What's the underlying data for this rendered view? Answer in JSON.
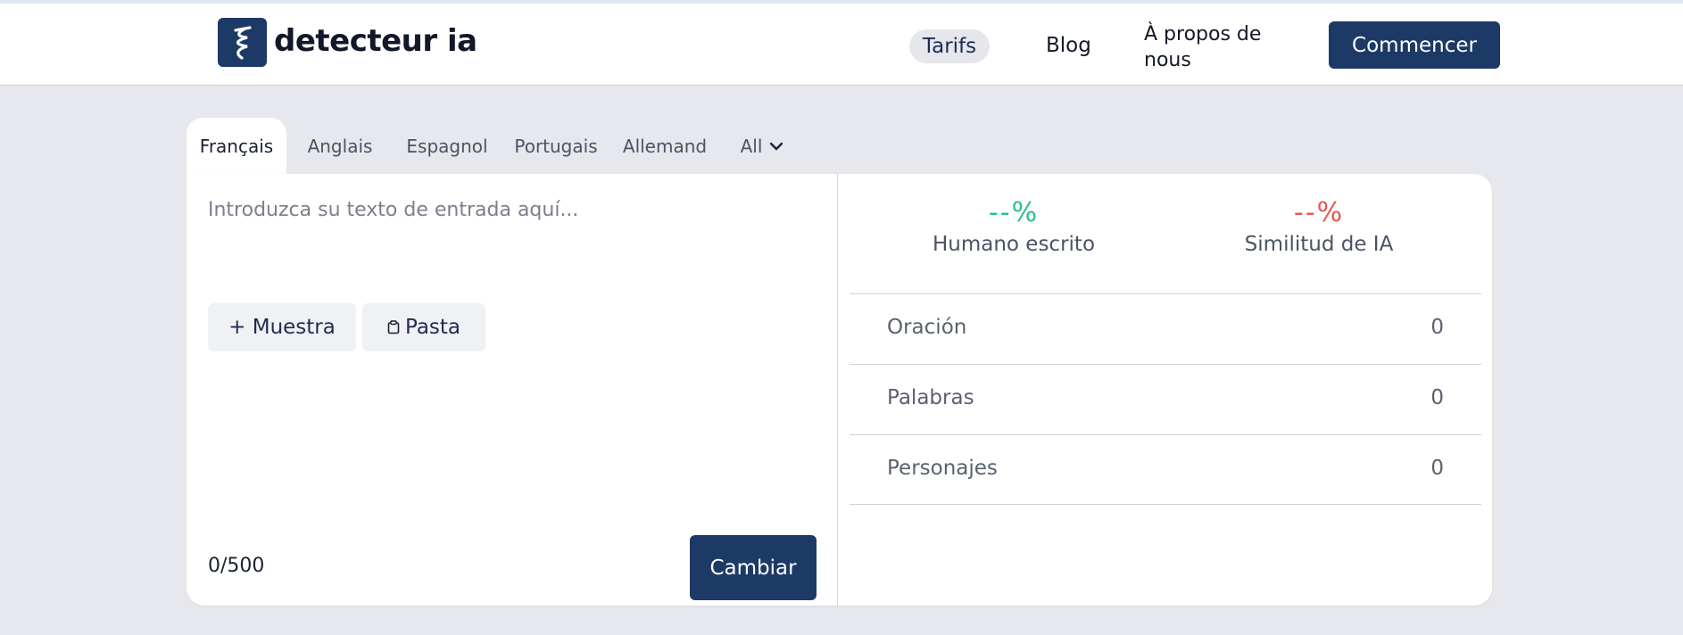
{
  "header": {
    "logo_text": "detecteur ia",
    "nav": {
      "tarifs": "Tarifs",
      "blog": "Blog",
      "about": "À propos de nous"
    },
    "cta": "Commencer"
  },
  "tabs": [
    {
      "label": "Français",
      "active": true
    },
    {
      "label": "Anglais"
    },
    {
      "label": "Espagnol"
    },
    {
      "label": "Portugais"
    },
    {
      "label": "Allemand"
    },
    {
      "label": "All"
    }
  ],
  "input": {
    "placeholder": "Introduzca su texto de entrada aquí...",
    "sample_button": "+ Muestra",
    "paste_button": "Pasta",
    "counter": "0/500",
    "submit_button": "Cambiar"
  },
  "results": {
    "human": {
      "value": "--%",
      "label": "Humano escrito",
      "color": "#2bbf8a"
    },
    "ai": {
      "value": "--%",
      "label": "Similitud de IA",
      "color": "#e8574f"
    },
    "stats": [
      {
        "label": "Oración",
        "value": "0"
      },
      {
        "label": "Palabras",
        "value": "0"
      },
      {
        "label": "Personajes",
        "value": "0"
      }
    ]
  },
  "icons": {
    "logo": "spiral-logo-icon",
    "tab_dropdown": "chevron-down-icon",
    "paste": "clipboard-icon"
  }
}
